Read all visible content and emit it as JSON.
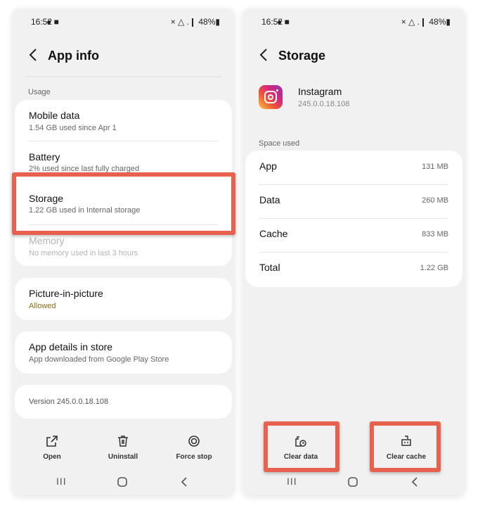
{
  "left": {
    "status": {
      "time": "16:52",
      "notif_icons": "● ■",
      "right": "× △ .❙ 48%▮"
    },
    "title": "App info",
    "usage_label": "Usage",
    "rows": [
      {
        "title": "Mobile data",
        "sub": "1.54 GB used since Apr 1"
      },
      {
        "title": "Battery",
        "sub": "2% used since last fully charged"
      },
      {
        "title": "Storage",
        "sub": "1.22 GB used in Internal storage"
      },
      {
        "title": "Memory",
        "sub": "No memory used in last 3 hours"
      }
    ],
    "pip": {
      "title": "Picture-in-picture",
      "sub": "Allowed"
    },
    "store": {
      "title": "App details in store",
      "sub": "App downloaded from Google Play Store"
    },
    "version": "Version 245.0.0.18.108",
    "actions": [
      {
        "label": "Open",
        "icon": "open-external-icon"
      },
      {
        "label": "Uninstall",
        "icon": "trash-icon"
      },
      {
        "label": "Force stop",
        "icon": "force-stop-icon"
      }
    ]
  },
  "right": {
    "status": {
      "time": "16:52",
      "notif_icons": "● ■",
      "right": "× △ .❙ 48%▮"
    },
    "title": "Storage",
    "app": {
      "name": "Instagram",
      "version": "245.0.0.18.108",
      "icon": "instagram-icon"
    },
    "space_label": "Space used",
    "rows": [
      {
        "label": "App",
        "value": "131 MB"
      },
      {
        "label": "Data",
        "value": "260 MB"
      },
      {
        "label": "Cache",
        "value": "833 MB"
      },
      {
        "label": "Total",
        "value": "1.22 GB"
      }
    ],
    "actions": [
      {
        "label": "Clear data",
        "icon": "clear-data-icon"
      },
      {
        "label": "Clear cache",
        "icon": "clear-cache-icon"
      }
    ]
  },
  "nav": {
    "recents": "III",
    "home": "◯",
    "back": "<"
  },
  "colors": {
    "highlight": "#e8604e",
    "card": "#ffffff",
    "background": "#f1f1f1",
    "allowed": "#8b6d1a"
  }
}
